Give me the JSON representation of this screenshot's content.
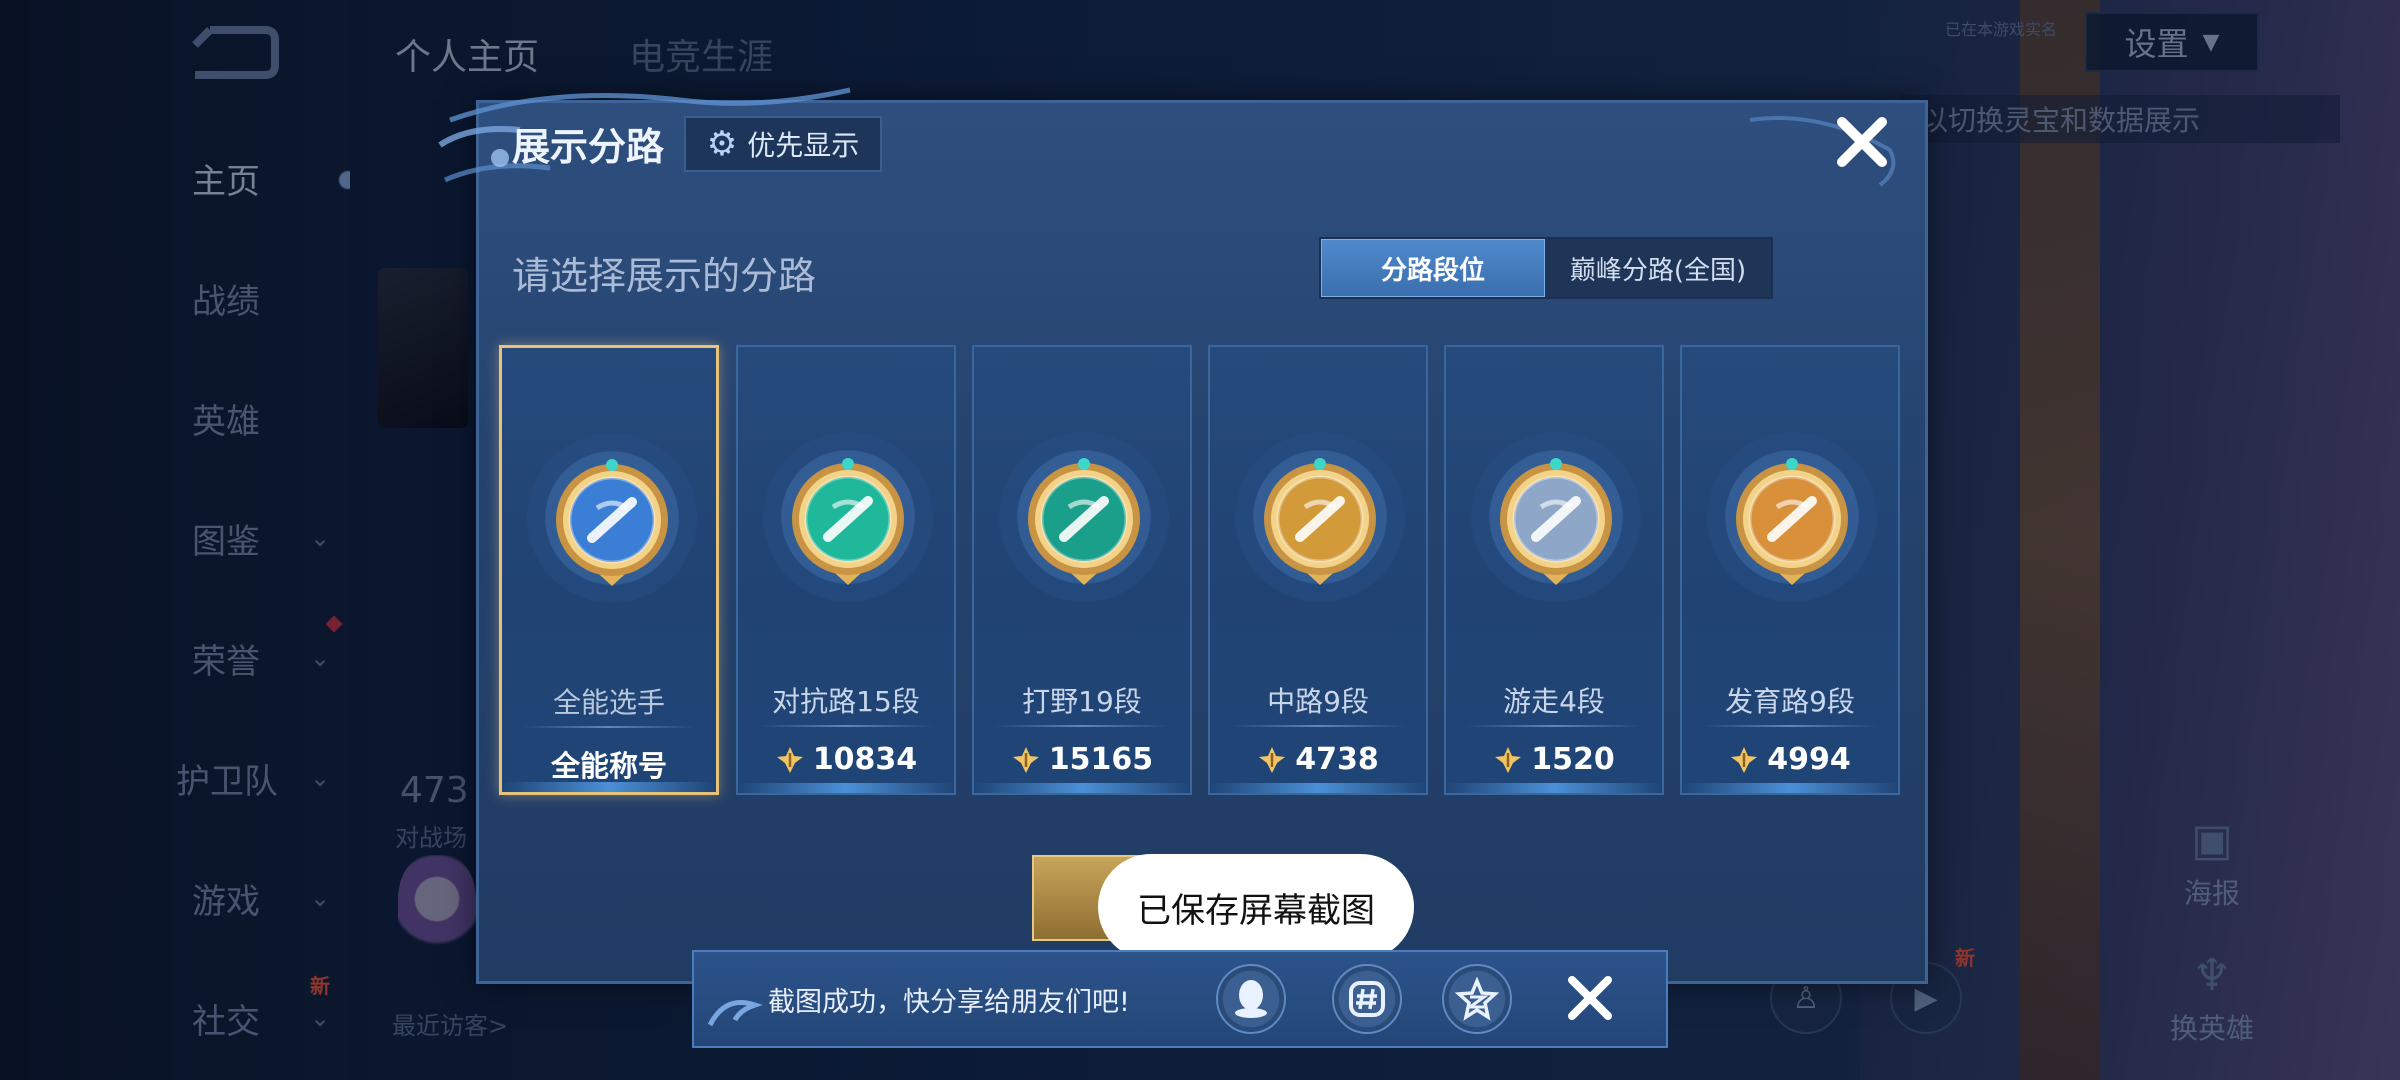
{
  "nav": {
    "items": [
      {
        "label": "主页",
        "active": true
      },
      {
        "label": "战绩"
      },
      {
        "label": "英雄"
      },
      {
        "label": "图鉴"
      },
      {
        "label": "荣誉"
      },
      {
        "label": "护卫队"
      },
      {
        "label": "游戏"
      },
      {
        "label": "社交"
      }
    ],
    "new_badge": "新"
  },
  "top_tabs": [
    "个人主页",
    "电竞生涯"
  ],
  "background": {
    "stat_value": "473",
    "stat_label": "对战场",
    "recent_visitors": "最近访客>",
    "settings_label": "设置",
    "settings_tiny": "已在本游戏实名",
    "switch_hint": "以切换灵宝和数据展示",
    "poster_label": "海报",
    "swap_hero_label": "换英雄",
    "new_badge": "新"
  },
  "modal": {
    "title": "展示分路",
    "priority_button": "优先显示",
    "prompt": "请选择展示的分路",
    "toggle": {
      "lane_rank": "分路段位",
      "peak_lane": "巅峰分路(全国)",
      "selected": "lane_rank"
    },
    "cards": [
      {
        "name": "全能选手",
        "score": "全能称号",
        "selected": true,
        "emblem": "all-round-icon",
        "color": "#3b7ed6"
      },
      {
        "name": "对抗路15段",
        "score": "10834",
        "emblem": "clash-lane-icon",
        "color": "#20b89a"
      },
      {
        "name": "打野19段",
        "score": "15165",
        "emblem": "jungle-icon",
        "color": "#1aa08a"
      },
      {
        "name": "中路9段",
        "score": "4738",
        "emblem": "mid-lane-icon",
        "color": "#d39a3a"
      },
      {
        "name": "游走4段",
        "score": "1520",
        "emblem": "roam-icon",
        "color": "#8ea6c8"
      },
      {
        "name": "发育路9段",
        "score": "4994",
        "emblem": "farm-lane-icon",
        "color": "#d8913a"
      }
    ]
  },
  "toast": "已保存屏幕截图",
  "share": {
    "text": "截图成功，快分享给朋友们吧!",
    "icons": [
      "qq-icon",
      "wechat-moments-icon",
      "qzone-icon"
    ]
  }
}
